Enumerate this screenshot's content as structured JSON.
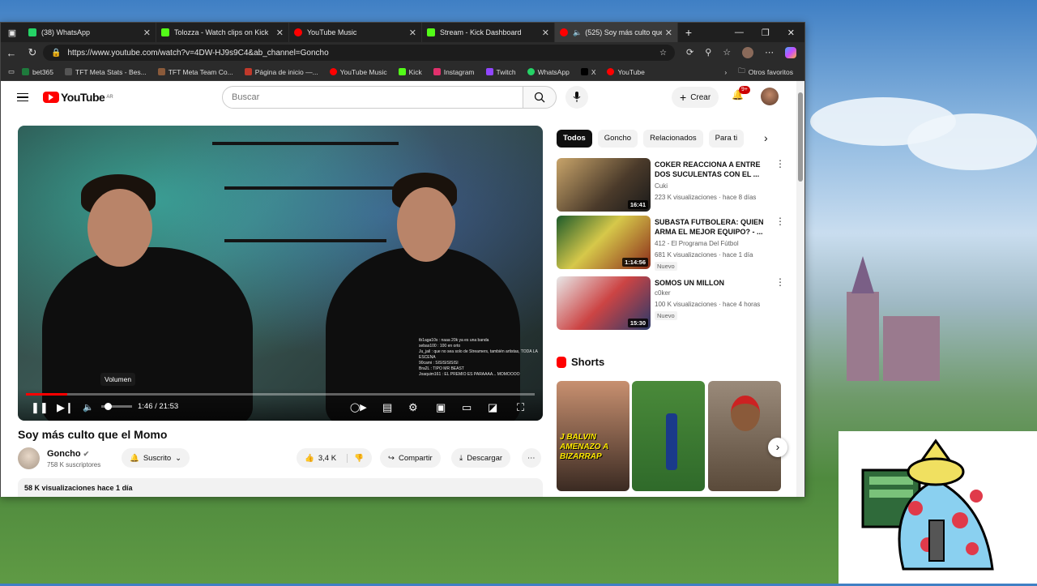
{
  "tabs": [
    {
      "label": "(38) WhatsApp",
      "color": "#25d366"
    },
    {
      "label": "Tolozza - Watch clips on Kick",
      "color": "#53fc18"
    },
    {
      "label": "YouTube Music",
      "color": "#ff0000"
    },
    {
      "label": "Stream - Kick Dashboard",
      "color": "#53fc18"
    },
    {
      "label": "(525) Soy más culto que el ",
      "color": "#ff0000"
    }
  ],
  "address": {
    "url": "https://www.youtube.com/watch?v=4DW-HJ9s9C4&ab_channel=Goncho"
  },
  "bookmarks": [
    {
      "label": "bet365",
      "color": "#1e7a3c"
    },
    {
      "label": "TFT Meta Stats - Bes...",
      "color": "#444"
    },
    {
      "label": "TFT Meta Team Co...",
      "color": "#8a5a3a"
    },
    {
      "label": "Página de inicio —...",
      "color": "#c0392b"
    },
    {
      "label": "YouTube Music",
      "color": "#ff0000"
    },
    {
      "label": "Kick",
      "color": "#53fc18"
    },
    {
      "label": "Instagram",
      "color": "#e1306c"
    },
    {
      "label": "Twitch",
      "color": "#9146ff"
    },
    {
      "label": "WhatsApp",
      "color": "#25d366"
    },
    {
      "label": "X",
      "color": "#000"
    },
    {
      "label": "YouTube",
      "color": "#ff0000"
    }
  ],
  "bookmarks_other": "Otros favoritos",
  "yt": {
    "logo": "YouTube",
    "region": "AR",
    "search_placeholder": "Buscar",
    "create": "Crear",
    "notif_badge": "9+"
  },
  "player": {
    "tooltip": "Volumen",
    "time": "1:46 / 21:53",
    "progress_fraction": 0.081,
    "chat_lines": [
      "tb1aga10s : naaa 20k ya es una banda",
      "sebas100 : 100 en orto",
      "Ju_jail : que no sea solo de Streamers, también artistas, TODA LA ESCENA",
      "90cami : SISISISISISI",
      "Bra2L : TIPO MR BEAST",
      "Joaquim161 : EL PREMIO ES PARAAAA... MOMOOOO"
    ]
  },
  "video": {
    "title": "Soy más culto que el Momo",
    "channel": "Goncho",
    "subs": "758 K suscriptores",
    "subscribed": "Suscrito",
    "likes": "3,4 K",
    "share": "Compartir",
    "download": "Descargar",
    "views": "58 K visualizaciones  hace 1 día"
  },
  "chips": [
    "Todos",
    "Goncho",
    "Relacionados",
    "Para ti"
  ],
  "recommended": [
    {
      "title": "COKER REACCIONA A ENTRE DOS SUCULENTAS CON EL ...",
      "channel": "Cuki",
      "meta": "223 K visualizaciones · hace 8 días",
      "duration": "16:41",
      "badge": ""
    },
    {
      "title": "SUBASTA FUTBOLERA: QUIEN ARMA EL MEJOR EQUIPO? - ...",
      "channel": "412 - El Programa Del Fútbol",
      "meta": "681 K visualizaciones · hace 1 día",
      "duration": "1:14:56",
      "badge": "Nuevo"
    },
    {
      "title": "SOMOS UN MILLON",
      "channel": "c0ker",
      "meta": "100 K visualizaciones · hace 4 horas",
      "duration": "15:30",
      "badge": "Nuevo"
    }
  ],
  "shorts": {
    "heading": "Shorts",
    "first_caption": "J BALVIN AMENAZO A BIZARRAP"
  }
}
